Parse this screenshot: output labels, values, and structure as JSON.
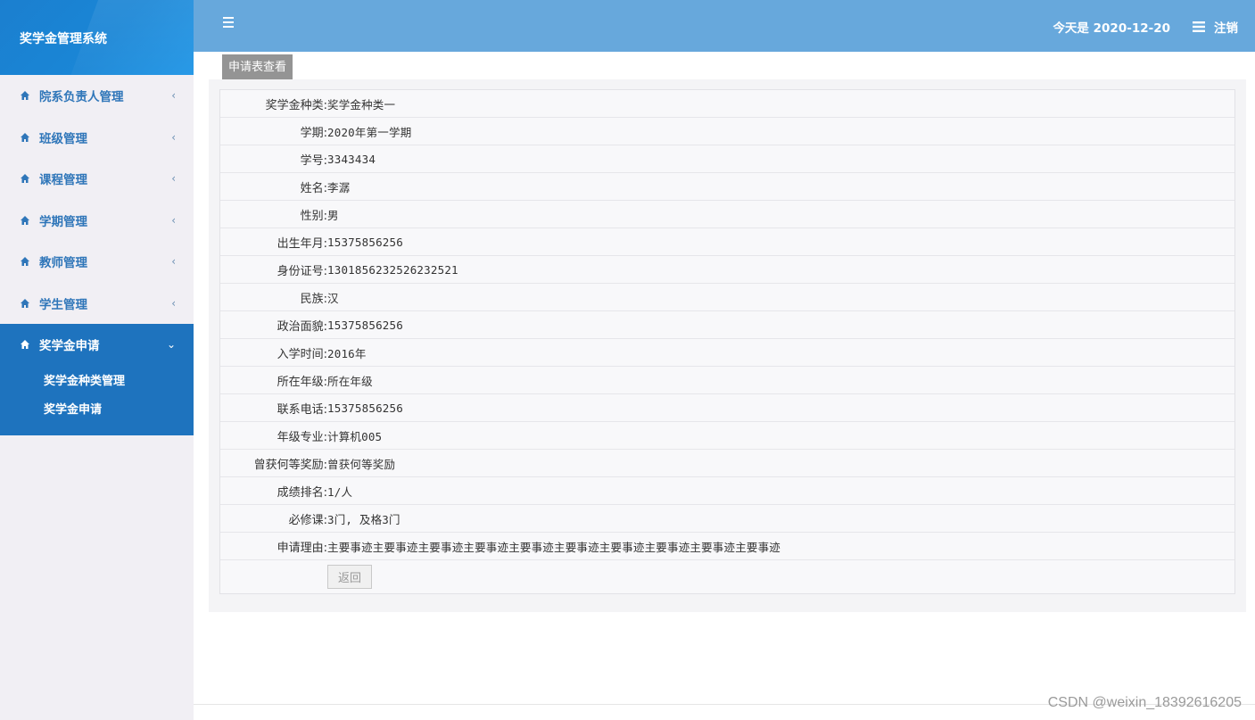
{
  "app": {
    "title": "奖学金管理系统"
  },
  "header": {
    "today_label": "今天是 2020-12-20",
    "logout_label": "注销"
  },
  "sidebar": {
    "items": [
      {
        "label": "院系负责人管理"
      },
      {
        "label": "班级管理"
      },
      {
        "label": "课程管理"
      },
      {
        "label": "学期管理"
      },
      {
        "label": "教师管理"
      },
      {
        "label": "学生管理"
      },
      {
        "label": "奖学金申请",
        "sub": [
          {
            "label": "奖学金种类管理"
          },
          {
            "label": "奖学金申请"
          }
        ]
      }
    ]
  },
  "tab": {
    "label": "申请表查看"
  },
  "form": {
    "rows": [
      {
        "label": "奖学金种类:",
        "value": "奖学金种类一"
      },
      {
        "label": "学期:",
        "value": "2020年第一学期"
      },
      {
        "label": "学号:",
        "value": "3343434"
      },
      {
        "label": "姓名:",
        "value": "李潺"
      },
      {
        "label": "性别:",
        "value": "男"
      },
      {
        "label": "出生年月:",
        "value": "15375856256"
      },
      {
        "label": "身份证号:",
        "value": "1301856232526232521"
      },
      {
        "label": "民族:",
        "value": "汉"
      },
      {
        "label": "政治面貌:",
        "value": "15375856256"
      },
      {
        "label": "入学时间:",
        "value": "2016年"
      },
      {
        "label": "所在年级:",
        "value": "所在年级"
      },
      {
        "label": "联系电话:",
        "value": "15375856256"
      },
      {
        "label": "年级专业:",
        "value": "计算机005"
      },
      {
        "label": "曾获何等奖励:",
        "value": "曾获何等奖励"
      },
      {
        "label": "成绩排名:",
        "value": "1/人"
      },
      {
        "label": "必修课:",
        "value": "3门, 及格3门"
      },
      {
        "label": "申请理由:",
        "value": "主要事迹主要事迹主要事迹主要事迹主要事迹主要事迹主要事迹主要事迹主要事迹主要事迹"
      }
    ],
    "back_label": "返回"
  },
  "watermark": "CSDN @weixin_18392616205",
  "colors": {
    "sidebar_bg": "#f1eff4",
    "brand_bg": "#1b7fcf",
    "header_bg": "#67a8dc",
    "active_menu": "#1e73be",
    "menu_text": "#2f76b9"
  }
}
